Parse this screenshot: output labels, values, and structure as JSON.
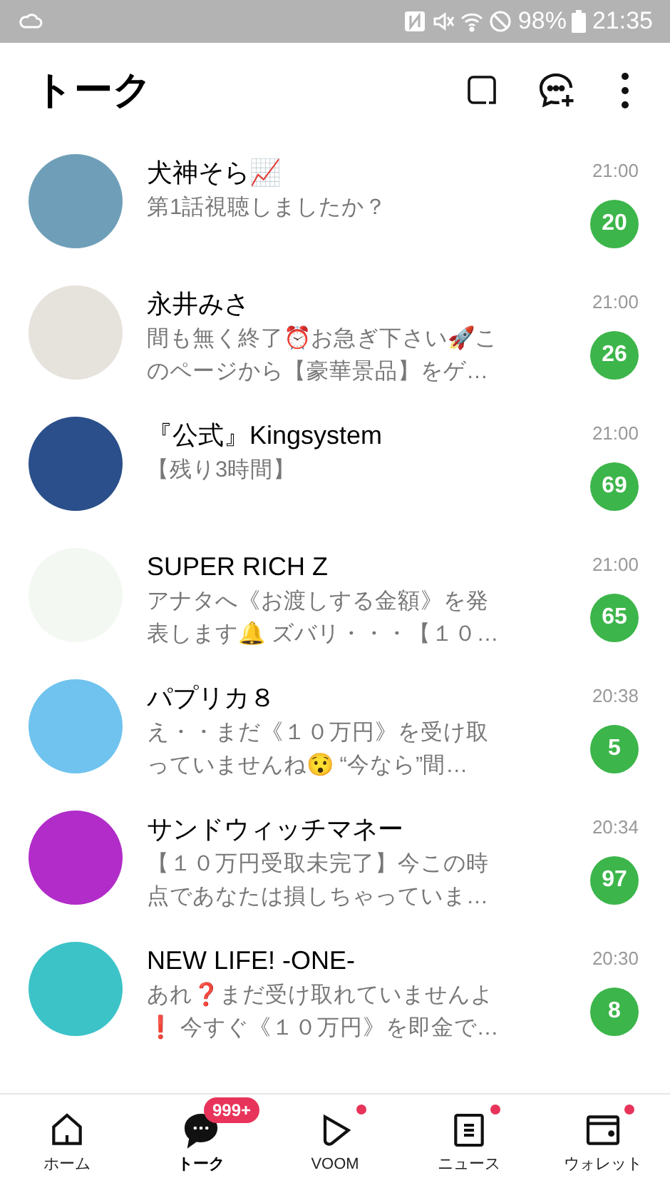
{
  "status_bar": {
    "battery": "98%",
    "time": "21:35"
  },
  "header": {
    "title": "トーク"
  },
  "chats": [
    {
      "name": "犬神そら📈",
      "message": "第1話視聴しましたか？",
      "time": "21:00",
      "unread": "20"
    },
    {
      "name": "永井みさ",
      "message": "間も無く終了⏰お急ぎ下さい🚀このページから【豪華景品】をゲ…",
      "time": "21:00",
      "unread": "26"
    },
    {
      "name": "『公式』Kingsystem",
      "message": "【残り3時間】",
      "time": "21:00",
      "unread": "69"
    },
    {
      "name": "SUPER RICH Z",
      "message": "アナタへ《お渡しする金額》を発表します🔔 ズバリ・・・【１０…",
      "time": "21:00",
      "unread": "65"
    },
    {
      "name": "パプリカ８",
      "message": "え・・まだ《１０万円》を受け取っていませんね😯 “今なら”間…",
      "time": "20:38",
      "unread": "5"
    },
    {
      "name": "サンドウィッチマネー",
      "message": "【１０万円受取未完了】今この時点であなたは損しちゃっていま…",
      "time": "20:34",
      "unread": "97"
    },
    {
      "name": "NEW LIFE! -ONE-",
      "message": "あれ❓まだ受け取れていませんよ❗ 今すぐ《１０万円》を即金で…",
      "time": "20:30",
      "unread": "8"
    }
  ],
  "nav": [
    {
      "kind": "home",
      "label": "ホーム",
      "selected": false,
      "dot": false
    },
    {
      "kind": "talk",
      "label": "トーク",
      "selected": true,
      "dot": false,
      "badge": "999+"
    },
    {
      "kind": "voom",
      "label": "VOOM",
      "selected": false,
      "dot": true
    },
    {
      "kind": "news",
      "label": "ニュース",
      "selected": false,
      "dot": true
    },
    {
      "kind": "wallet",
      "label": "ウォレット",
      "selected": false,
      "dot": true
    }
  ]
}
